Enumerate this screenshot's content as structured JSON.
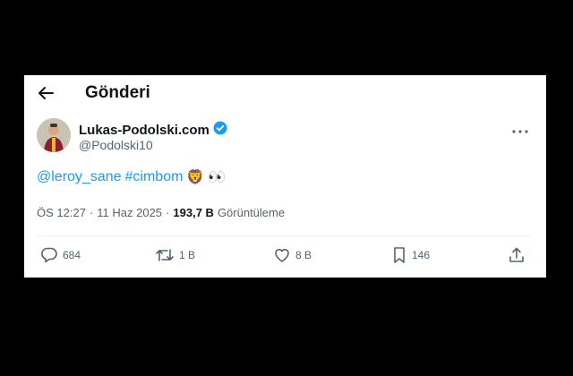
{
  "header": {
    "title": "Gönderi"
  },
  "tweet": {
    "display_name": "Lukas-Podolski.com",
    "handle": "@Podolski10",
    "mention": "@leroy_sane",
    "hashtag": "#cimbom",
    "emoji_lion": "🦁",
    "emoji_eyes": "👀",
    "time": "ÖS 12:27",
    "date_sep": "·",
    "date": "11 Haz 2025",
    "views_sep": "·",
    "views": "193,7 B",
    "views_label": "Görüntüleme"
  },
  "actions": {
    "replies": "684",
    "reposts": "1 B",
    "likes": "8 B",
    "bookmarks": "146"
  },
  "colors": {
    "link": "#1d9bf0",
    "verified": "#1d9bf0",
    "muted": "#536471"
  }
}
